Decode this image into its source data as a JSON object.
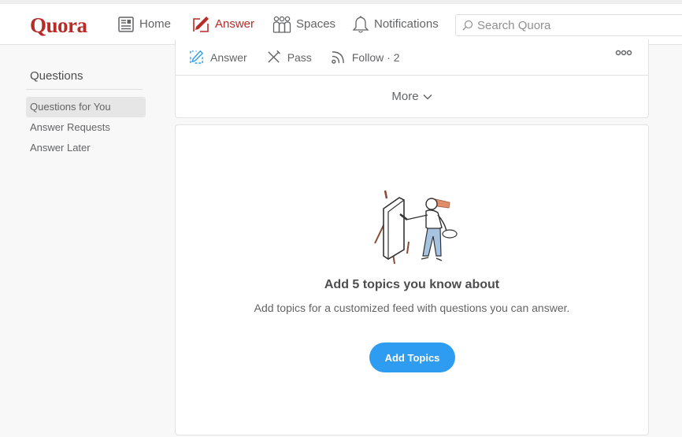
{
  "header": {
    "logo": "Quora",
    "nav": [
      {
        "label": "Home",
        "icon": "home-feed-icon",
        "active": false
      },
      {
        "label": "Answer",
        "icon": "pencil-square-icon",
        "active": true
      },
      {
        "label": "Spaces",
        "icon": "people-icon",
        "active": false
      },
      {
        "label": "Notifications",
        "icon": "bell-icon",
        "active": false
      }
    ],
    "search": {
      "placeholder": "Search Quora",
      "value": ""
    }
  },
  "sidebar": {
    "title": "Questions",
    "items": [
      {
        "label": "Questions for You",
        "active": true
      },
      {
        "label": "Answer Requests",
        "active": false
      },
      {
        "label": "Answer Later",
        "active": false
      }
    ]
  },
  "question_card": {
    "actions": [
      {
        "label": "Answer",
        "icon": "answer-pencil-icon"
      },
      {
        "label": "Pass",
        "icon": "pass-icon"
      },
      {
        "label": "Follow",
        "icon": "follow-rss-icon",
        "count_text": " · 2"
      }
    ],
    "more_label": "More"
  },
  "empty_state": {
    "title": "Add 5 topics you know about",
    "subtitle": "Add topics for a customized feed with questions you can answer.",
    "button_label": "Add Topics"
  },
  "colors": {
    "brand": "#b92b27",
    "button": "#2e9df1",
    "answer_icon": "#2e9df1"
  }
}
